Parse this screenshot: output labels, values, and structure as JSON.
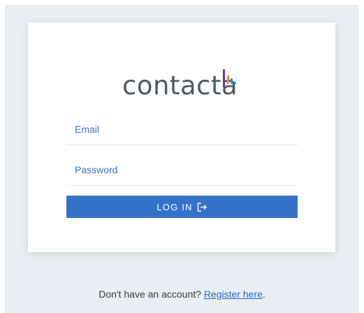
{
  "logo": {
    "text": "contacta"
  },
  "form": {
    "email_placeholder": "Email",
    "password_placeholder": "Password",
    "login_label": "LOG IN"
  },
  "footer": {
    "prompt": "Don't have an account?",
    "register_link": "Register here",
    "end": "."
  },
  "icons": {
    "login_icon": "login-arrow-icon"
  },
  "colors": {
    "accent": "#3472c9",
    "background": "#e8eef1",
    "logo_text": "#4d5a63",
    "logo_bar_purple": "#7b2f9a",
    "logo_bar_orange": "#f0883a",
    "logo_bar_blue": "#2f8fd8"
  }
}
